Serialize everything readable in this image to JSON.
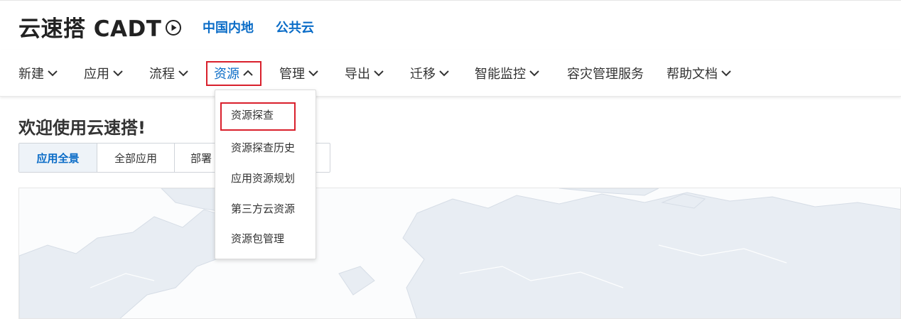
{
  "header": {
    "app_title": "云速搭 CADT",
    "play_icon": "play-circle-icon",
    "regions": [
      "中国内地",
      "公共云"
    ]
  },
  "nav": {
    "items": [
      {
        "label": "新建",
        "has_chevron": true
      },
      {
        "label": "应用",
        "has_chevron": true
      },
      {
        "label": "流程",
        "has_chevron": true
      },
      {
        "label": "资源",
        "has_chevron": true,
        "active": true,
        "expanded": true
      },
      {
        "label": "管理",
        "has_chevron": true
      },
      {
        "label": "导出",
        "has_chevron": true
      },
      {
        "label": "迁移",
        "has_chevron": true
      },
      {
        "label": "智能监控",
        "has_chevron": true
      },
      {
        "label": "容灾管理服务",
        "has_chevron": false
      },
      {
        "label": "帮助文档",
        "has_chevron": true
      }
    ]
  },
  "dropdown": {
    "items": [
      "资源探查",
      "资源探查历史",
      "应用资源规划",
      "第三方云资源",
      "资源包管理"
    ],
    "highlighted_index": 0
  },
  "main": {
    "welcome": "欢迎使用云速搭!",
    "tabs": [
      {
        "label": "应用全景",
        "active": true
      },
      {
        "label": "全部应用"
      },
      {
        "label": "部署"
      }
    ]
  },
  "colors": {
    "accent": "#0a6cc7",
    "highlight_border": "#d9202c",
    "map_land": "#e8edf3"
  }
}
